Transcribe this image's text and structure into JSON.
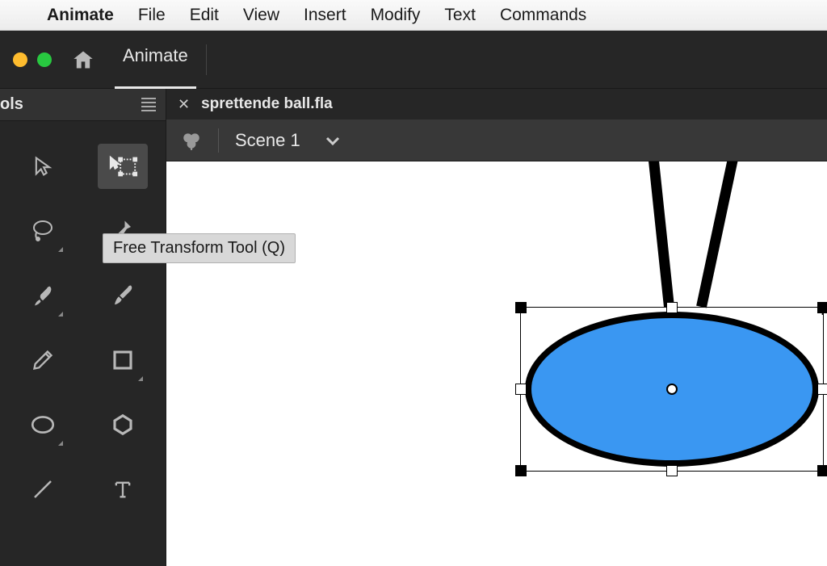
{
  "menubar": {
    "items": [
      "Animate",
      "File",
      "Edit",
      "View",
      "Insert",
      "Modify",
      "Text",
      "Commands"
    ]
  },
  "app_header": {
    "workspace_label": "Animate"
  },
  "tools_panel": {
    "title": "ols"
  },
  "document": {
    "filename": "sprettende ball.fla",
    "scene_label": "Scene 1"
  },
  "tooltip": {
    "text": "Free Transform Tool (Q)"
  }
}
